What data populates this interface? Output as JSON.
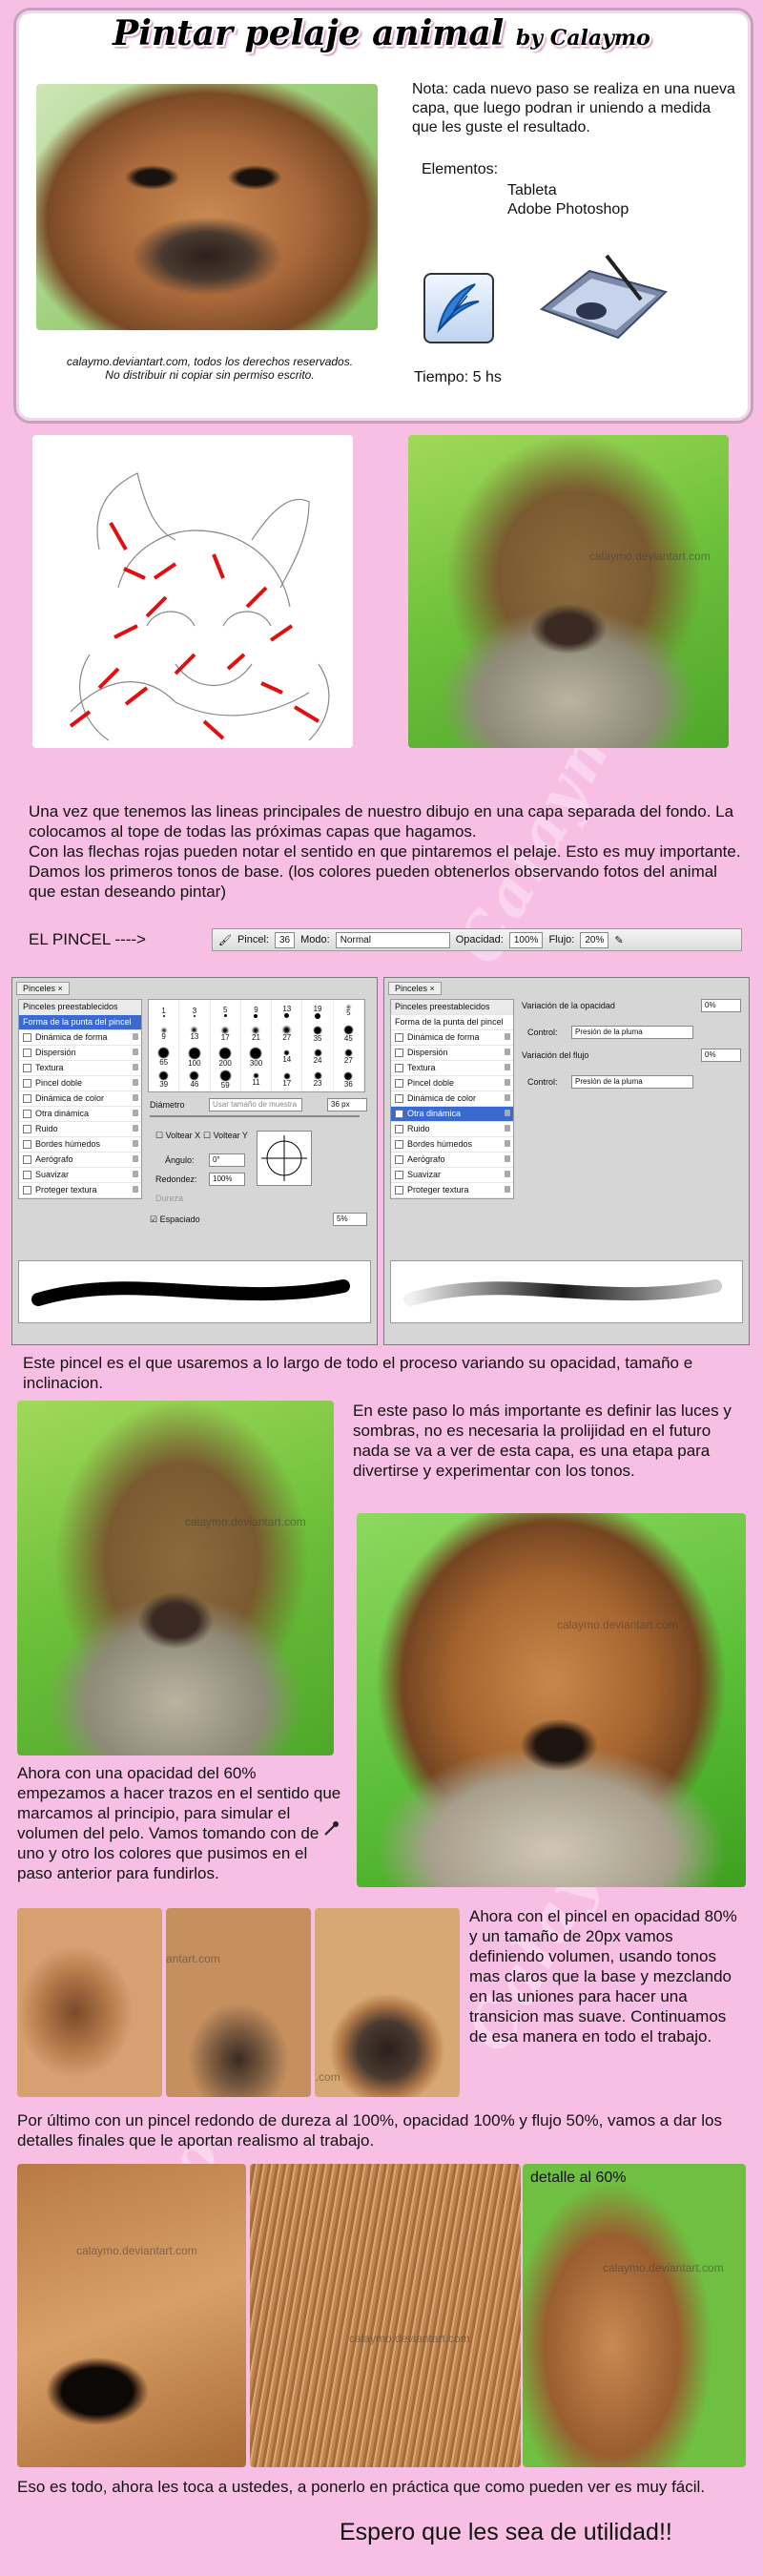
{
  "header": {
    "title": "Pintar pelaje animal",
    "by": "by Calaymo",
    "note": "Nota: cada nuevo paso se realiza en una nueva capa, que luego podran ir uniendo a medida que les guste el resultado.",
    "elements_label": "Elementos:",
    "elements": [
      "Tableta",
      "Adobe Photoshop"
    ],
    "time": "Tiempo: 5 hs",
    "copyright_line1": "calaymo.deviantart.com, todos los derechos reservados.",
    "copyright_line2": "No distribuir ni copiar sin permiso escrito."
  },
  "watermark": "calaymo.deviantart.com",
  "background_watermark": "Calaymo",
  "steps": {
    "step1": "Una vez que tenemos las lineas principales de nuestro dibujo en una capa separada del fondo. La colocamos al tope de todas las próximas capas que hagamos.\nCon las flechas rojas pueden notar el sentido en que pintaremos el pelaje. Esto es muy importante. Damos los primeros tonos de base. (los colores pueden obtenerlos observando fotos del animal que estan deseando pintar)",
    "pincel_label": "EL PINCEL ---->",
    "step2": "Este pincel es el que usaremos a lo largo de todo el proceso variando su opacidad, tamaño e inclinacion.",
    "step3": "En este paso lo más importante es definir las luces y sombras, no es necesaria la prolijidad en el futuro nada se va a ver de esta capa, es una etapa para divertirse y experimentar con los tonos.",
    "step4": "Ahora con una opacidad del 60% empezamos a hacer trazos en el sentido que marcamos al principio, para simular el volumen del pelo. Vamos tomando con de uno y otro los colores que pusimos en el paso anterior para fundirlos.",
    "step5": "Ahora con el pincel en opacidad 80% y un tamaño de 20px vamos definiendo volumen, usando tonos mas claros que la base y mezclando en las uniones para hacer una transicion mas suave. Continuamos de esa manera en todo el trabajo.",
    "step6": "Por último con un pincel redondo de dureza al 100%, opacidad 100% y flujo 50%, vamos a dar los detalles finales que le aportan realismo al trabajo.",
    "detail_label": "detalle al 60%",
    "final": "Eso es todo, ahora les toca a ustedes, a ponerlo en práctica que como pueden ver es muy fácil.",
    "closing": "Espero que les sea de utilidad!!"
  },
  "toolbar": {
    "pincel": "Pincel:",
    "brush_size": "36",
    "modo": "Modo:",
    "modo_value": "Normal",
    "opacidad": "Opacidad:",
    "opacidad_value": "100%",
    "flujo": "Flujo:",
    "flujo_value": "20%"
  },
  "panel_left": {
    "tab": "Pinceles ×",
    "items": [
      "Pinceles preestablecidos",
      "Forma de la punta del pincel",
      "Dinámica de forma",
      "Dispersión",
      "Textura",
      "Pincel doble",
      "Dinámica de color",
      "Otra dinámica",
      "Ruido",
      "Bordes húmedos",
      "Aerógrafo",
      "Suavizar",
      "Proteger textura"
    ],
    "brush_sizes": [
      "1",
      "3",
      "5",
      "9",
      "13",
      "19",
      "5",
      "9",
      "13",
      "17",
      "21",
      "27",
      "35",
      "45",
      "65",
      "100",
      "200",
      "300",
      "14",
      "24",
      "27",
      "39",
      "46",
      "59",
      "11",
      "17",
      "23",
      "36"
    ],
    "diametro": "Diámetro",
    "diametro_placeholder": "Usar tamaño de muestra",
    "diametro_value": "36 px",
    "voltear_x": "Voltear X",
    "voltear_y": "Voltear Y",
    "angulo": "Ángulo:",
    "angulo_value": "0°",
    "redondez": "Redondez:",
    "redondez_value": "100%",
    "dureza": "Dureza",
    "espaciado": "Espaciado",
    "espaciado_value": "5%"
  },
  "panel_right": {
    "tab": "Pinceles ×",
    "items": [
      "Pinceles preestablecidos",
      "Forma de la punta del pincel",
      "Dinámica de forma",
      "Dispersión",
      "Textura",
      "Pincel doble",
      "Dinámica de color",
      "Otra dinámica",
      "Ruido",
      "Bordes húmedos",
      "Aerógrafo",
      "Suavizar",
      "Proteger textura"
    ],
    "opacity_var": "Variación de la opacidad",
    "opacity_var_value": "0%",
    "control": "Control:",
    "control_value": "Presión de la pluma",
    "flow_var": "Variación del flujo",
    "flow_var_value": "0%",
    "control2_value": "Presión de la pluma"
  },
  "colors": {
    "background": "#f7bfe3",
    "arrow": "#e01010",
    "selected": "#3a6ad0"
  }
}
